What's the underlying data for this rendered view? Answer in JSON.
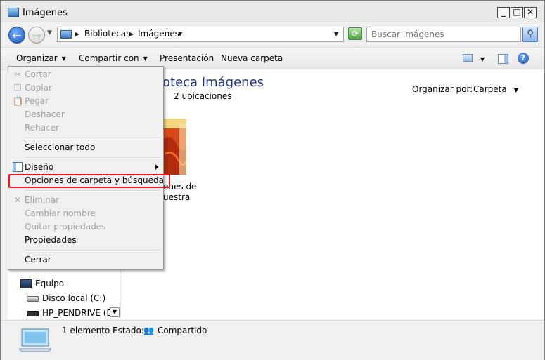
{
  "window": {
    "title": "Imágenes"
  },
  "address": {
    "segments": [
      "Bibliotecas",
      "Imágenes"
    ]
  },
  "search": {
    "placeholder": "Buscar Imágenes"
  },
  "toolbar": {
    "organize": "Organizar",
    "share": "Compartir con",
    "presentation": "Presentación",
    "new_folder": "Nueva carpeta"
  },
  "library": {
    "title": "oteca Imágenes",
    "subtitle": "2 ubicaciones",
    "arrange_label": "Organizar por:",
    "arrange_value": "Carpeta",
    "folder_label_line1": "enes de",
    "folder_label_line2": "uestra"
  },
  "nav_tree": {
    "computer": "Equipo",
    "local_disk": "Disco local (C:)",
    "pendrive": "HP_PENDRIVE (D:"
  },
  "menu": {
    "cut": "Cortar",
    "copy": "Copiar",
    "paste": "Pegar",
    "undo": "Deshacer",
    "redo": "Rehacer",
    "select_all": "Seleccionar todo",
    "layout": "Diseño",
    "folder_options": "Opciones de carpeta y búsqueda",
    "delete": "Eliminar",
    "rename": "Cambiar nombre",
    "remove_properties": "Quitar propiedades",
    "properties": "Propiedades",
    "close": "Cerrar"
  },
  "status": {
    "count": "1 elemento",
    "state_label": "Estado:",
    "state_value": "Compartido"
  }
}
